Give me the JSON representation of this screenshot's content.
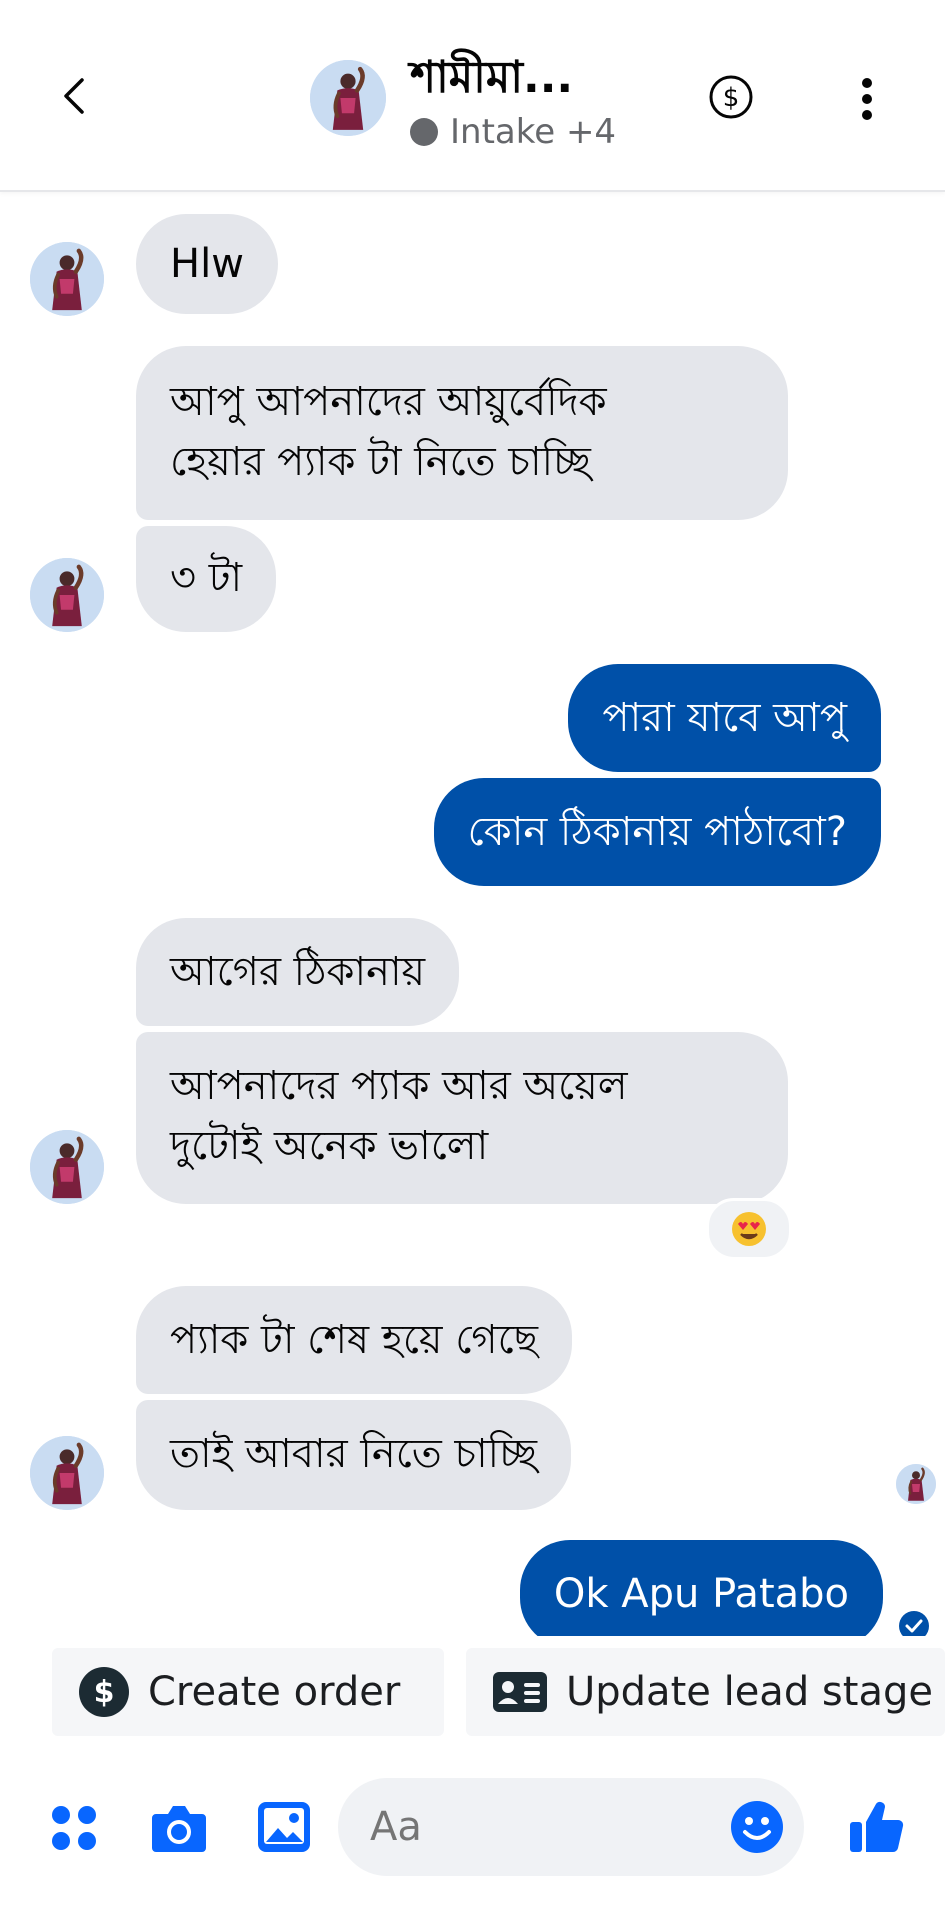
{
  "header": {
    "title": "শামীমা...",
    "status": "Intake +4"
  },
  "messages": [
    {
      "side": "in",
      "text": [
        "Hlw"
      ]
    },
    {
      "side": "in",
      "text": [
        "আপু আপনাদের আয়ুর্বেদিক",
        "হেয়ার প্যাক টা নিতে চাচ্ছি"
      ]
    },
    {
      "side": "in",
      "text": [
        "৩ টা"
      ]
    },
    {
      "side": "out",
      "text": [
        "পারা যাবে আপু"
      ]
    },
    {
      "side": "out",
      "text": [
        "কোন ঠিকানায় পাঠাবো?"
      ]
    },
    {
      "side": "in",
      "text": [
        "আগের ঠিকানায়"
      ]
    },
    {
      "side": "in",
      "text": [
        "আপনাদের প্যাক আর অয়েল",
        "দুটোই অনেক ভালো"
      ],
      "reaction": "heart-eyes-emoji"
    },
    {
      "side": "in",
      "text": [
        "প্যাক টা শেষ হয়ে গেছে"
      ]
    },
    {
      "side": "in",
      "text": [
        "তাই আবার নিতে চাচ্ছি"
      ]
    },
    {
      "side": "out",
      "text": [
        "Ok Apu Patabo"
      ]
    }
  ],
  "actions": {
    "create_order": "Create order",
    "update_lead_stage": "Update lead stage"
  },
  "composer": {
    "placeholder": "Aa"
  },
  "colors": {
    "outgoing_bubble": "#0050a8",
    "incoming_bubble": "#e4e6eb",
    "accent": "#0866ff"
  }
}
